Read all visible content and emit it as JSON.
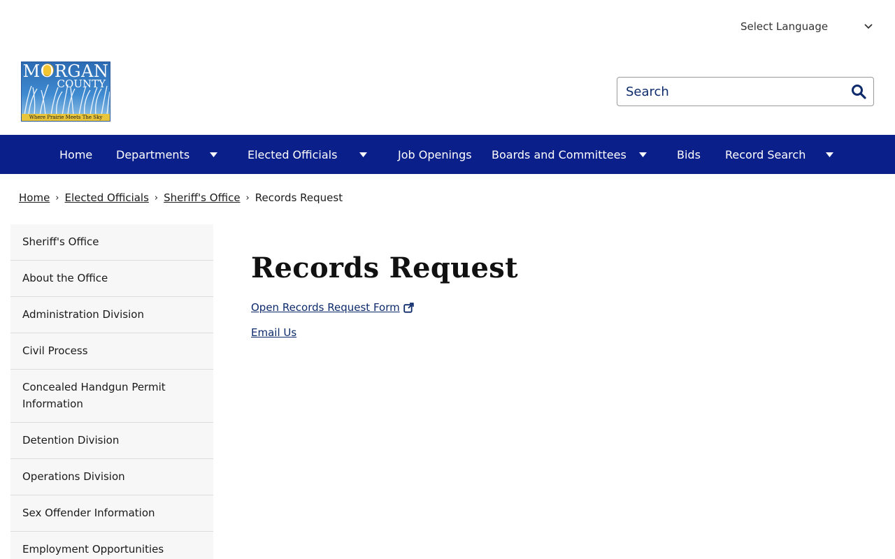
{
  "header": {
    "language_select": "Select Language",
    "search": {
      "placeholder": "Search"
    },
    "logo": {
      "title": "MORGAN",
      "subtitle": "COUNTY",
      "tagline": "Where Prairie Meets The Sky"
    }
  },
  "nav": {
    "items": [
      {
        "label": "Home",
        "has_dropdown": false
      },
      {
        "label": "Departments",
        "has_dropdown": true
      },
      {
        "label": "Elected Officials",
        "has_dropdown": true
      },
      {
        "label": "Job Openings",
        "has_dropdown": false
      },
      {
        "label": "Boards and Committees",
        "has_dropdown": true
      },
      {
        "label": "Bids",
        "has_dropdown": false
      },
      {
        "label": "Record Search",
        "has_dropdown": true
      }
    ]
  },
  "breadcrumb": {
    "items": [
      "Home",
      "Elected Officials",
      "Sheriff's Office"
    ],
    "current": "Records Request"
  },
  "sidebar": {
    "items": [
      "Sheriff's Office",
      "About the Office",
      "Administration Division",
      "Civil Process",
      "Concealed Handgun Permit Information",
      "Detention Division",
      "Operations Division",
      "Sex Offender Information",
      "Employment Opportunities"
    ]
  },
  "main": {
    "title": "Records Request",
    "links": [
      "Open Records Request Form",
      "Email Us"
    ]
  },
  "colors": {
    "nav_bg": "#0a1f8a",
    "link": "#0d2a6b",
    "sidebar_bg": "#f7f7f7"
  }
}
